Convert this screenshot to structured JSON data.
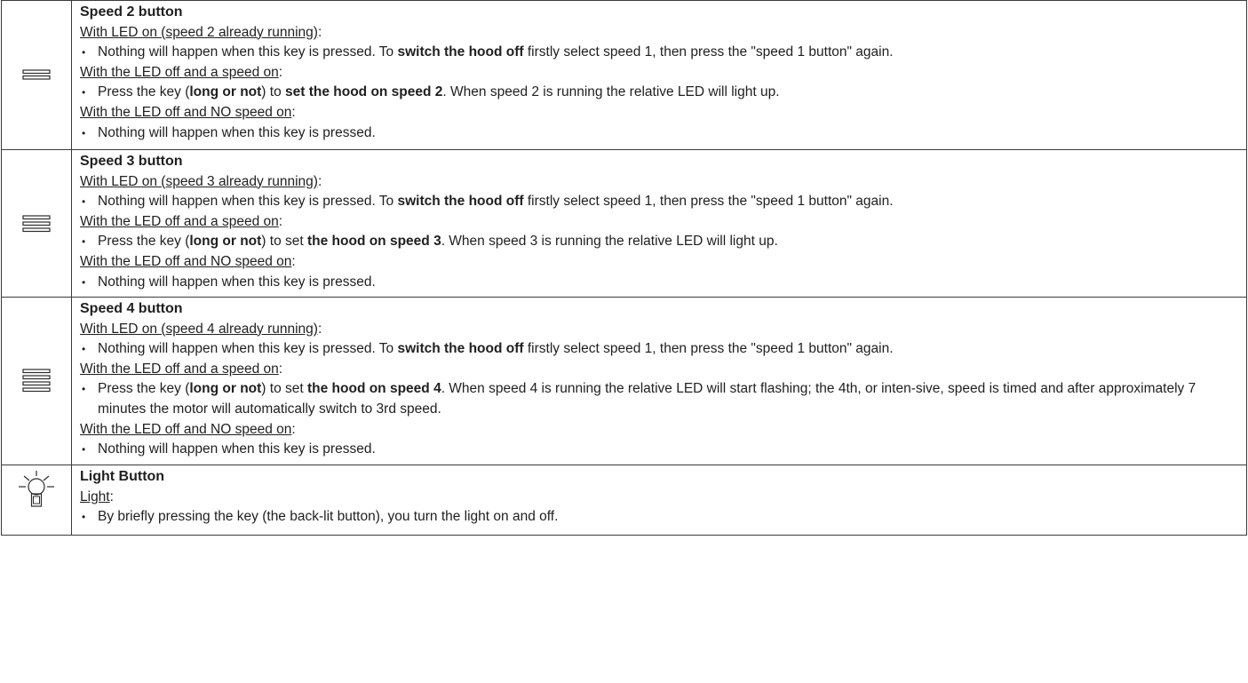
{
  "rows": [
    {
      "icon": "speed-2-bars-icon",
      "title": "Speed 2 button",
      "cond1": "With LED on (speed 2 already running)",
      "b1": {
        "p1": "Nothing will happen when this key is pressed. To ",
        "b1": "switch the hood off",
        "p2": " firstly select speed 1, then press the \"speed 1 button\" again."
      },
      "cond2": "With the LED off and a speed on",
      "b2": {
        "p1": "Press the key (",
        "b1": "long or not",
        "p2": ") to ",
        "b2": "set the hood on speed 2",
        "p3": ". When speed 2 is running the relative LED will light up."
      },
      "cond3": "With the LED off and NO speed on",
      "b3": "Nothing will happen when this key is pressed."
    },
    {
      "icon": "speed-3-bars-icon",
      "title": "Speed 3 button",
      "cond1": "With LED on (speed 3 already running)",
      "b1": {
        "p1": "Nothing will happen when this key is pressed. To ",
        "b1": "switch the hood off",
        "p2": " firstly select speed 1, then press the \"speed 1 button\" again."
      },
      "cond2": "With the LED off and a speed on",
      "b2": {
        "p1": "Press the key (",
        "b1": "long or not",
        "p2": ") to set ",
        "b2": "the hood on speed 3",
        "p3": ". When speed 3 is running the relative LED will light up."
      },
      "cond3": "With the LED off and NO speed on",
      "b3": "Nothing will happen when this key is pressed."
    },
    {
      "icon": "speed-4-bars-icon",
      "title": "Speed 4 button",
      "cond1": "With LED on (speed 4 already running)",
      "b1": {
        "p1": "Nothing will happen when this key is pressed. To ",
        "b1": "switch the hood off",
        "p2": " firstly select speed 1, then press the \"speed 1 button\" again."
      },
      "cond2": "With the LED off and a speed on",
      "b2": {
        "p1": "Press the key (",
        "b1": "long or not",
        "p2": ") to set ",
        "b2": "the hood on speed 4",
        "p3": ". When speed 4 is running the relative LED will start flashing; the 4th, or inten-sive, speed is timed and after approximately 7 minutes the motor will automatically switch to 3rd speed."
      },
      "cond3": "With the LED off and NO speed on",
      "b3": "Nothing will happen when this key is pressed."
    },
    {
      "icon": "light-bulb-icon",
      "title": "Light Button",
      "cond1": "Light",
      "b1": "By briefly pressing the key (the back-lit button), you turn the light on and off."
    }
  ]
}
